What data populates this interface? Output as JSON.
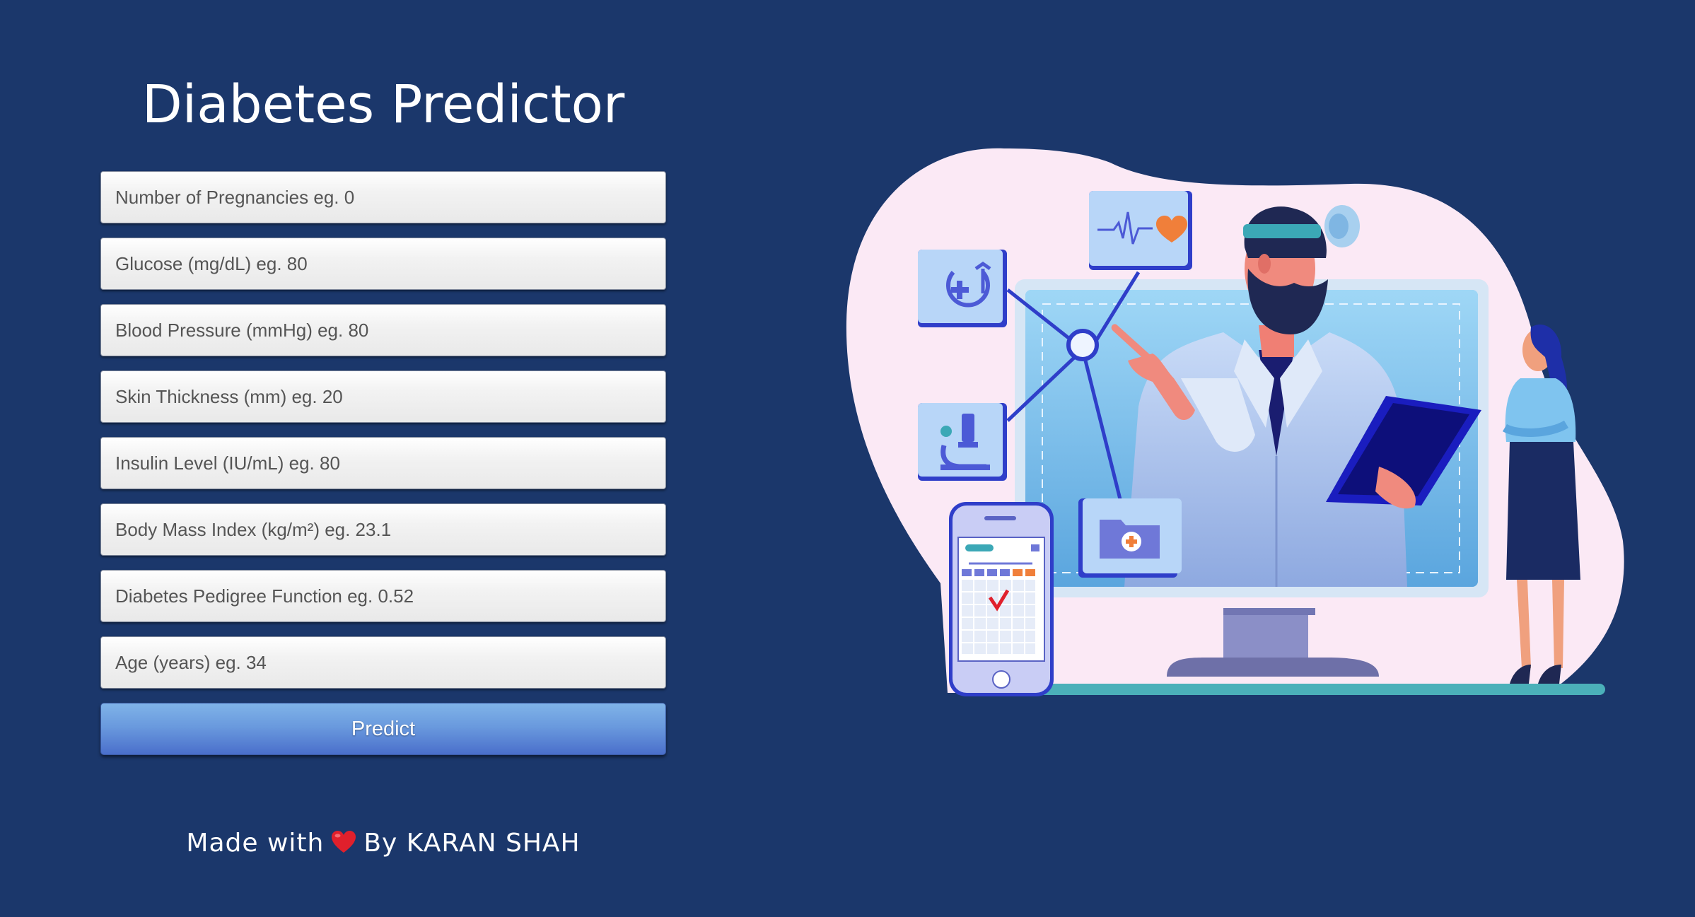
{
  "header": {
    "title": "Diabetes Predictor"
  },
  "form": {
    "fields": [
      {
        "placeholder": "Number of Pregnancies eg. 0"
      },
      {
        "placeholder": "Glucose (mg/dL) eg. 80"
      },
      {
        "placeholder": "Blood Pressure (mmHg) eg. 80"
      },
      {
        "placeholder": "Skin Thickness (mm) eg. 20"
      },
      {
        "placeholder": "Insulin Level (IU/mL) eg. 80"
      },
      {
        "placeholder": "Body Mass Index (kg/m²) eg. 23.1"
      },
      {
        "placeholder": "Diabetes Pedigree Function eg. 0.52"
      },
      {
        "placeholder": "Age (years) eg. 34"
      }
    ],
    "submit_label": "Predict"
  },
  "footer": {
    "prefix": "Made with",
    "heart_icon": "heart-icon",
    "suffix": "By KARAN SHAH"
  },
  "colors": {
    "background": "#1b376b",
    "button": "#6a9ade",
    "heart": "#e0202c",
    "illustration_blob": "#fbe9f5"
  }
}
